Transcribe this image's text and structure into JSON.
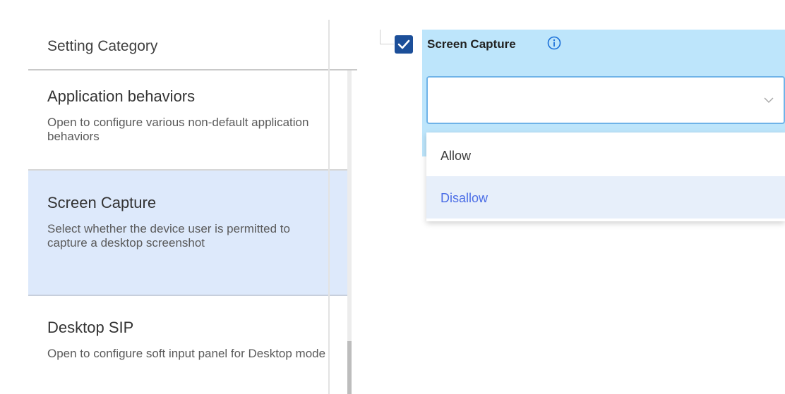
{
  "sidebar": {
    "header": "Setting Category",
    "items": [
      {
        "title": "Application behaviors",
        "description": "Open to configure various non-default application behaviors",
        "selected": false
      },
      {
        "title": "Screen Capture",
        "description": "Select whether the device user is permitted to capture a desktop screenshot",
        "selected": true
      },
      {
        "title": "Desktop SIP",
        "description": "Open to configure soft input panel for Desktop mode",
        "selected": false
      }
    ]
  },
  "setting": {
    "label": "Screen Capture",
    "checked": true,
    "value": "",
    "options": [
      "Allow",
      "Disallow"
    ],
    "highlighted_option": "Disallow"
  },
  "colors": {
    "selected_bg": "#dde9fb",
    "selected_bar": "#1f4fd6",
    "setting_bg": "#bde5fb",
    "checkbox": "#1c4f99",
    "highlight_text": "#4b6de6"
  }
}
